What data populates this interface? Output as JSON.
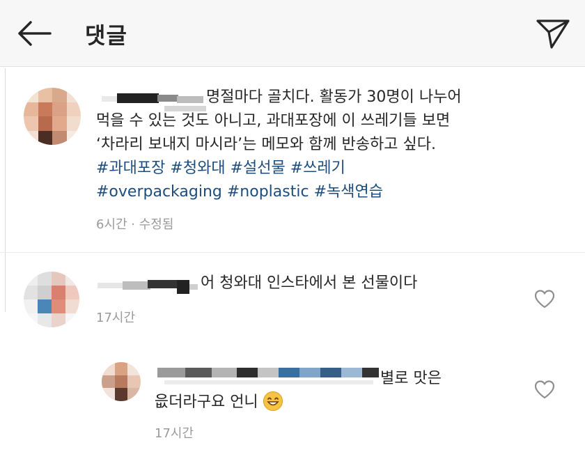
{
  "header": {
    "title": "댓글",
    "back_icon": "arrow-left-icon",
    "share_icon": "send-icon"
  },
  "comments": [
    {
      "text_lines": [
        "명절마다 골치다. 활동가 30명이 나누어",
        "먹을 수 있는 것도 아니고, 과대포장에 이 쓰레기들 보면",
        "‘차라리 보내지 마시라’는 메모와 함께 반송하고 싶다."
      ],
      "hashtags_line1": [
        "#과대포장",
        "#청와대",
        "#설선물",
        "#쓰레기"
      ],
      "hashtags_line2": [
        "#overpackaging",
        "#noplastic",
        "#녹색연습"
      ],
      "meta": "6시간 · 수정됨"
    },
    {
      "text": "어 청와대 인스타에서 본 선물이다",
      "meta": "17시간"
    },
    {
      "text_line1": "별로 맛은",
      "text_line2": "읎더라구요 언니",
      "meta": "17시간"
    }
  ],
  "colors": {
    "hashtag": "#1c4d7e",
    "meta": "#9a9a9a",
    "header_bg": "#f7f7f7"
  }
}
